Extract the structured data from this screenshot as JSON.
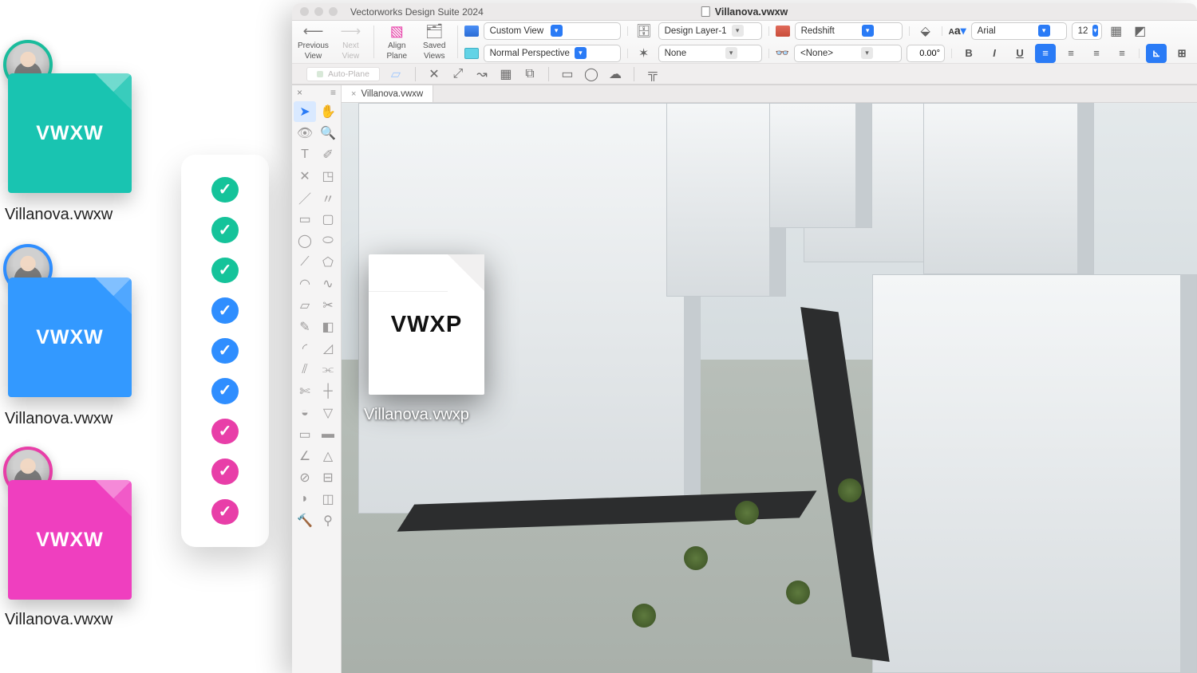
{
  "collab": {
    "files": [
      {
        "ext_label": "VWXW",
        "filename": "Villanova.vwxw",
        "color": "teal"
      },
      {
        "ext_label": "VWXW",
        "filename": "Villanova.vwxw",
        "color": "blue"
      },
      {
        "ext_label": "VWXW",
        "filename": "Villanova.vwxw",
        "color": "pink"
      }
    ],
    "checklist_colors": [
      "teal",
      "teal",
      "teal",
      "blue",
      "blue",
      "blue",
      "pink",
      "pink",
      "pink"
    ]
  },
  "window": {
    "app_title": "Vectorworks Design Suite 2024",
    "document_title": "Villanova.vwxw"
  },
  "toolbar": {
    "nav": {
      "previous": {
        "label_l1": "Previous",
        "label_l2": "View",
        "enabled": true
      },
      "next": {
        "label_l1": "Next",
        "label_l2": "View",
        "enabled": false
      },
      "align": {
        "label_l1": "Align",
        "label_l2": "Plane"
      },
      "saved": {
        "label_l1": "Saved",
        "label_l2": "Views"
      }
    },
    "view_dd": "Custom View",
    "perspective_dd": "Normal Perspective",
    "layer_dd": "Design Layer-1",
    "class_dd": "None",
    "render_dd": "Redshift",
    "visibility_dd": "<None>",
    "rotation": "0.00°",
    "font_dd": "Arial",
    "font_size": "12",
    "auto_plane": "Auto-Plane"
  },
  "tabs": {
    "active": "Villanova.vwxw"
  },
  "project_file": {
    "ext_label": "VWXP",
    "filename": "Villanova.vwxp"
  },
  "colors": {
    "teal": "#19c4b1",
    "blue": "#3399ff",
    "pink": "#ef3fbf",
    "accent": "#2a7bf6"
  }
}
